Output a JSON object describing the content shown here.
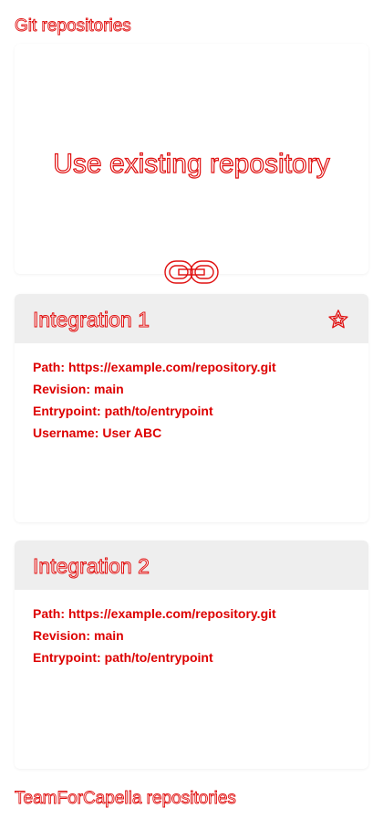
{
  "git_section": {
    "title": "Git repositories"
  },
  "use_existing": {
    "title": "Use existing repository",
    "icon": "link-icon"
  },
  "integrations": [
    {
      "title": "Integration 1",
      "favorite_icon": "star-icon",
      "details": [
        {
          "label": "Path:",
          "value": "https://example.com/repository.git"
        },
        {
          "label": "Revision:",
          "value": "main"
        },
        {
          "label": "Entrypoint:",
          "value": "path/to/entrypoint"
        },
        {
          "label": "Username:",
          "value": "User ABC"
        }
      ]
    },
    {
      "title": "Integration 2",
      "details": [
        {
          "label": "Path:",
          "value": "https://example.com/repository.git"
        },
        {
          "label": "Revision:",
          "value": "main"
        },
        {
          "label": "Entrypoint:",
          "value": "path/to/entrypoint"
        }
      ]
    }
  ],
  "team_section": {
    "title": "TeamForCapella repositories"
  },
  "colors": {
    "accent": "#e01010",
    "header_background": "#eeeeee",
    "page_background": "#ffffff"
  }
}
